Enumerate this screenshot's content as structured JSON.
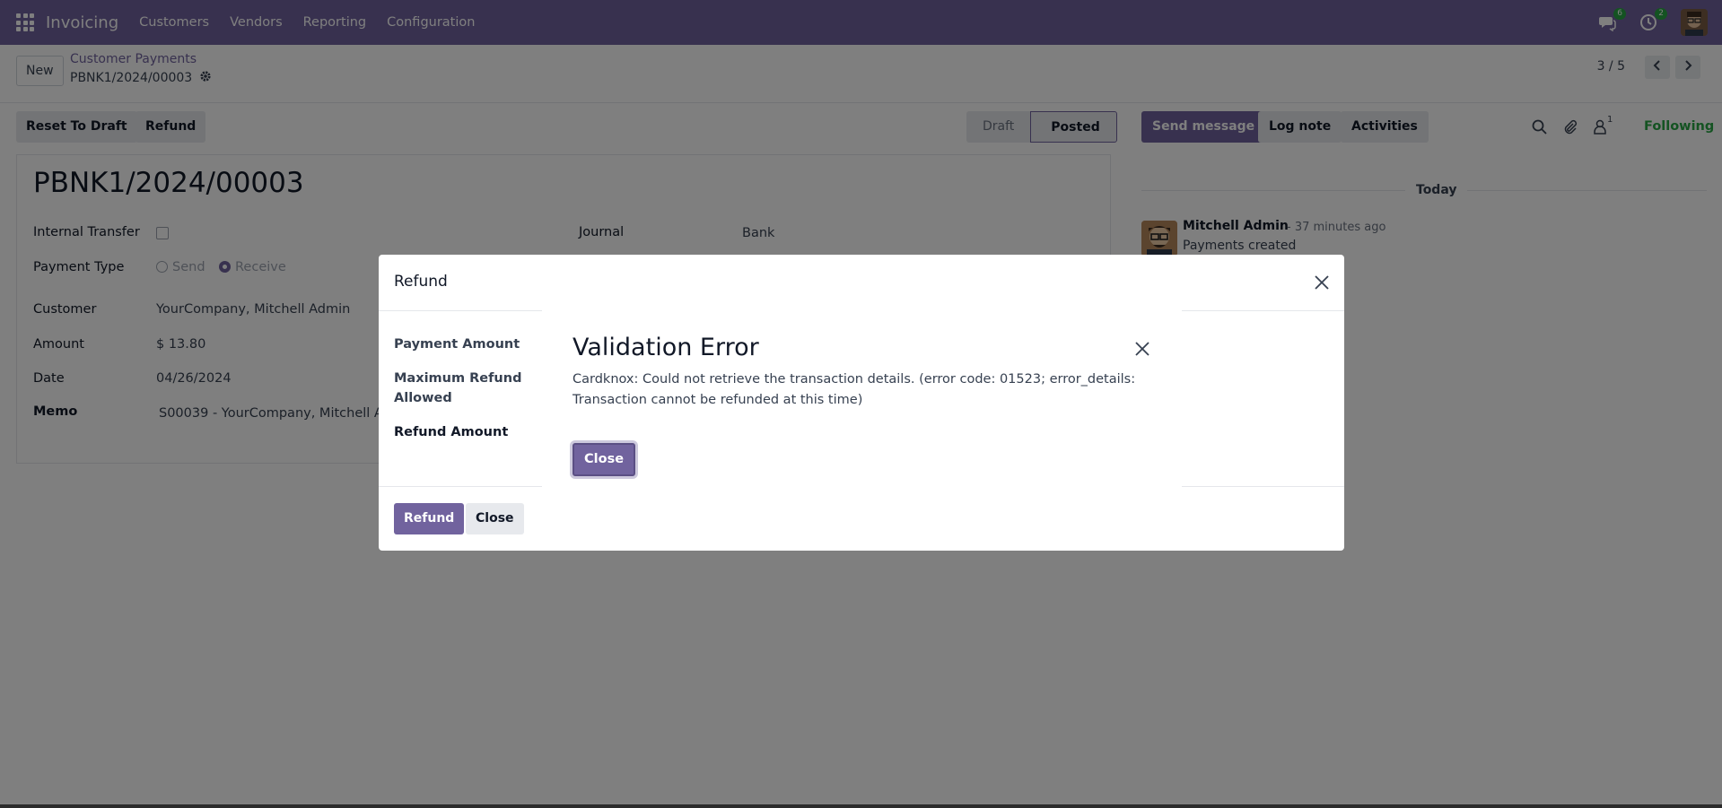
{
  "navbar": {
    "app_name": "Invoicing",
    "menu": [
      "Customers",
      "Vendors",
      "Reporting",
      "Configuration"
    ],
    "messages_count": "6",
    "activities_count": "2"
  },
  "control": {
    "new_label": "New",
    "breadcrumb": "Customer Payments",
    "record_name": "PBNK1/2024/00003",
    "pager": "3 / 5"
  },
  "actions": {
    "reset_label": "Reset To Draft",
    "refund_label": "Refund",
    "status_draft": "Draft",
    "status_posted": "Posted"
  },
  "chatter_buttons": {
    "send_message": "Send message",
    "log_note": "Log note",
    "activities": "Activities",
    "followers_count": "1",
    "following": "Following"
  },
  "form": {
    "title": "PBNK1/2024/00003",
    "internal_transfer_label": "Internal Transfer",
    "payment_type_label": "Payment Type",
    "payment_type_send": "Send",
    "payment_type_receive": "Receive",
    "customer_label": "Customer",
    "customer_value": "YourCompany, Mitchell Admin",
    "amount_label": "Amount",
    "amount_value": "$ 13.80",
    "date_label": "Date",
    "date_value": "04/26/2024",
    "memo_label": "Memo",
    "memo_value": "S00039 - YourCompany, Mitchell Ac",
    "journal_label": "Journal",
    "journal_value": "Bank"
  },
  "chatter": {
    "today": "Today",
    "author": "Mitchell Admin",
    "time": "- 37 minutes ago",
    "message": "Payments created"
  },
  "refund_dialog": {
    "title": "Refund",
    "payment_amount_label": "Payment Amount",
    "max_refund_label_1": "Maximum Refund",
    "max_refund_label_2": "Allowed",
    "refund_amount_label": "Refund Amount",
    "refund_button": "Refund",
    "close_button": "Close"
  },
  "error_dialog": {
    "title": "Validation Error",
    "message": "Cardknox: Could not retrieve the transaction details. (error code: 01523; error_details: Transaction cannot be refunded at this time)",
    "close_button": "Close"
  },
  "colors": {
    "brand": "#71639e",
    "success": "#28a745"
  }
}
